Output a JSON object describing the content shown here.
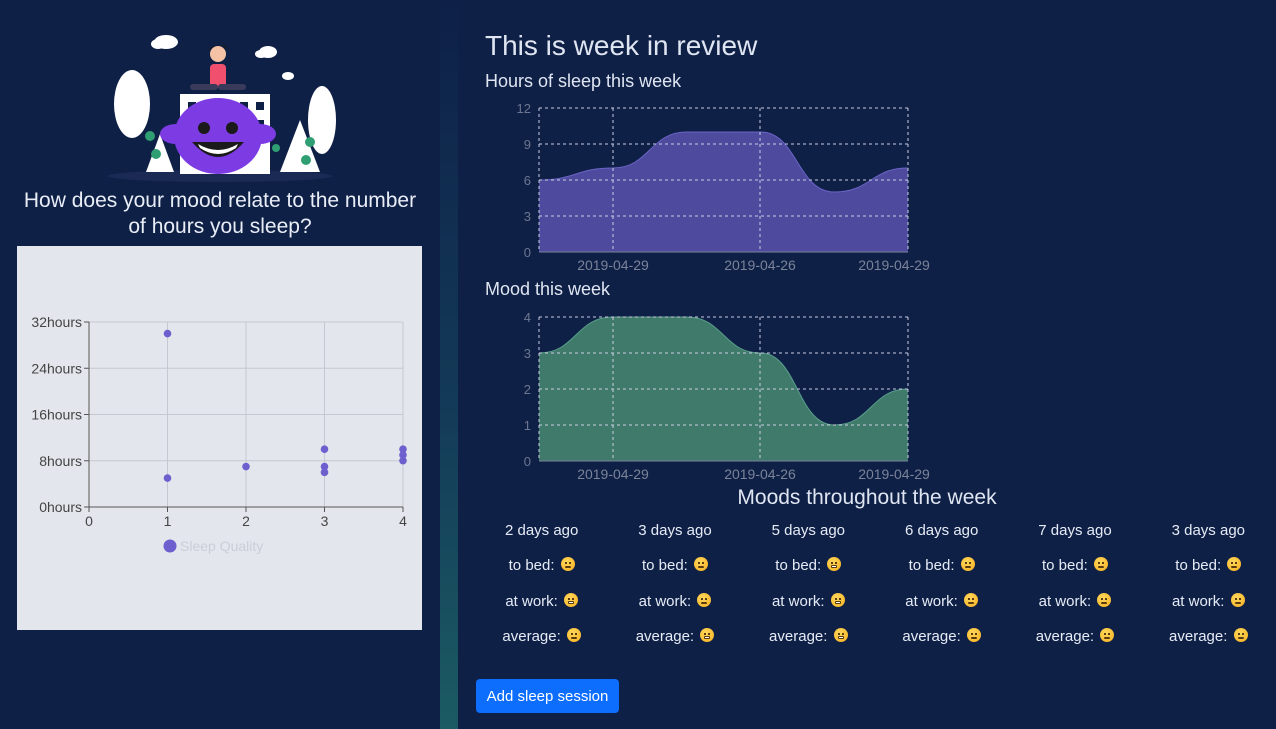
{
  "left": {
    "question": "How does your mood relate to the number of hours you sleep?",
    "scatter": {
      "y_tick_labels": [
        "32hours",
        "24hours",
        "16hours",
        "8hours",
        "0hours"
      ],
      "x_tick_labels": [
        "0",
        "1",
        "2",
        "3",
        "4"
      ],
      "legend_label": "Sleep Quality",
      "color": "#6e5fcf"
    }
  },
  "right": {
    "title": "This is week in review",
    "sleep_chart_title": "Hours of sleep this week",
    "mood_chart_title": "Mood this week",
    "moods_title": "Moods throughout the week",
    "add_button_label": "Add sleep session"
  },
  "colors": {
    "background": "#0f2047",
    "sleep_fill": "#4e4a9e",
    "mood_fill": "#3f7a6b",
    "button": "#0d6efd"
  },
  "moods": [
    {
      "day": "2 days ago",
      "bed_label": "to bed:",
      "bed_icon": "slight-smile-emoji",
      "work_label": "at work:",
      "work_icon": "grin-emoji",
      "avg_label": "average:",
      "avg_icon": "slight-smile-emoji"
    },
    {
      "day": "3 days ago",
      "bed_label": "to bed:",
      "bed_icon": "slight-smile-emoji",
      "work_label": "at work:",
      "work_icon": "slight-smile-emoji",
      "avg_label": "average:",
      "avg_icon": "grin-emoji"
    },
    {
      "day": "5 days ago",
      "bed_label": "to bed:",
      "bed_icon": "grin-emoji",
      "work_label": "at work:",
      "work_icon": "grin-emoji",
      "avg_label": "average:",
      "avg_icon": "grin-emoji"
    },
    {
      "day": "6 days ago",
      "bed_label": "to bed:",
      "bed_icon": "slight-smile-emoji",
      "work_label": "at work:",
      "work_icon": "slight-smile-emoji",
      "avg_label": "average:",
      "avg_icon": "slight-smile-emoji"
    },
    {
      "day": "7 days ago",
      "bed_label": "to bed:",
      "bed_icon": "neutral-emoji",
      "work_label": "at work:",
      "work_icon": "neutral-emoji",
      "avg_label": "average:",
      "avg_icon": "neutral-emoji"
    },
    {
      "day": "3 days ago",
      "bed_label": "to bed:",
      "bed_icon": "neutral-emoji",
      "work_label": "at work:",
      "work_icon": "slight-smile-emoji",
      "avg_label": "average:",
      "avg_icon": "slight-smile-emoji"
    }
  ],
  "chart_data": [
    {
      "type": "scatter",
      "title": "",
      "xlabel": "",
      "ylabel": "",
      "xlim": [
        0,
        4
      ],
      "ylim": [
        0,
        32
      ],
      "y_unit_suffix": "hours",
      "legend": "bottom-center",
      "grid": true,
      "series": [
        {
          "name": "Sleep Quality",
          "points": [
            [
              1,
              30
            ],
            [
              1,
              5
            ],
            [
              2,
              7
            ],
            [
              3,
              10
            ],
            [
              3,
              7
            ],
            [
              3,
              6
            ],
            [
              4,
              10
            ],
            [
              4,
              9
            ],
            [
              4,
              8
            ]
          ]
        }
      ]
    },
    {
      "type": "area",
      "title": "Hours of sleep this week",
      "ylim": [
        0,
        12
      ],
      "y_ticks": [
        0,
        3,
        6,
        9,
        12
      ],
      "x_tick_labels": [
        "2019-04-29",
        "2019-04-26",
        "2019-04-29"
      ],
      "grid": true,
      "values": [
        6,
        7,
        10,
        10,
        5,
        7
      ]
    },
    {
      "type": "area",
      "title": "Mood this week",
      "ylim": [
        0,
        4
      ],
      "y_ticks": [
        0,
        1,
        2,
        3,
        4
      ],
      "x_tick_labels": [
        "2019-04-29",
        "2019-04-26",
        "2019-04-29"
      ],
      "grid": true,
      "values": [
        3,
        4,
        4,
        3,
        1,
        2
      ]
    }
  ]
}
